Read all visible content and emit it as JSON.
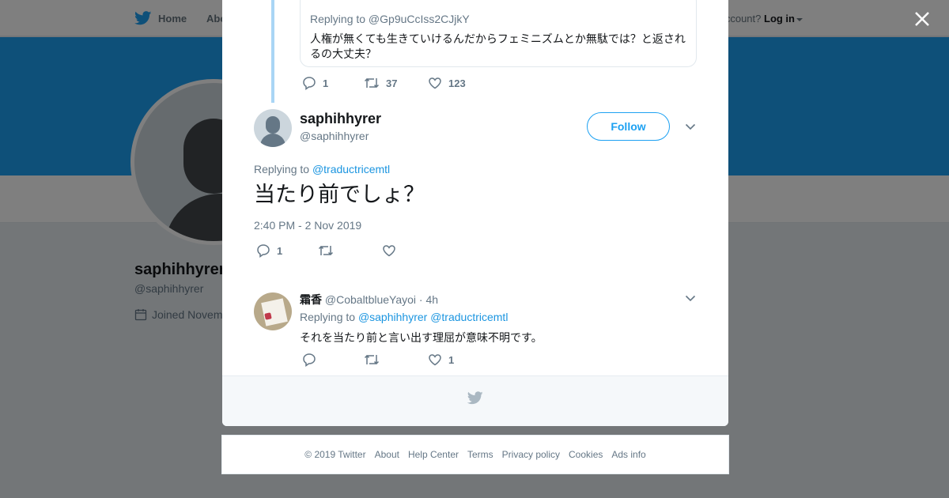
{
  "nav": {
    "home": "Home",
    "about_partial": "Abo",
    "account_partial": "account?",
    "login": "Log in"
  },
  "profile_bg": {
    "name": "saphihhyrer",
    "handle": "@saphihhyrer",
    "joined": "Joined Novem"
  },
  "quoted_tweet": {
    "replying_to": "Replying to @Gp9uCcIss2CJjkY",
    "text": "人権が無くても生きていけるんだからフェミニズムとか無駄では？と返されるの大丈夫？",
    "replies": "1",
    "retweets": "37",
    "likes": "123"
  },
  "main_tweet": {
    "name": "saphihhyrer",
    "handle": "@saphihhyrer",
    "follow_label": "Follow",
    "replying_prefix": "Replying to",
    "replying_handle": "@traductricemtl",
    "text": "当たり前でしょ？",
    "timestamp": "2:40 PM - 2 Nov 2019",
    "replies": "1",
    "retweets": "",
    "likes": ""
  },
  "reply_tweet": {
    "name": "霜香",
    "handle": "@CobaltblueYayoi",
    "time": "· 4h",
    "replying_prefix": "Replying to",
    "replying_handle_1": "@saphihhyrer",
    "replying_handle_2": "@traductricemtl",
    "text": "それを当たり前と言い出す理屈が意味不明です。",
    "replies": "",
    "retweets": "",
    "likes": "1"
  },
  "footer": {
    "copyright": "© 2019 Twitter",
    "about": "About",
    "help": "Help Center",
    "terms": "Terms",
    "privacy": "Privacy policy",
    "cookies": "Cookies",
    "ads": "Ads info"
  },
  "colors": {
    "brand_blue": "#1da1f2",
    "link_blue": "#1b95e0",
    "muted": "#657786",
    "thread_line": "#a9d5f5"
  },
  "icons": [
    "twitter-bird-icon",
    "close-icon",
    "reply-icon",
    "retweet-icon",
    "like-icon",
    "chevron-down-icon",
    "calendar-icon"
  ]
}
